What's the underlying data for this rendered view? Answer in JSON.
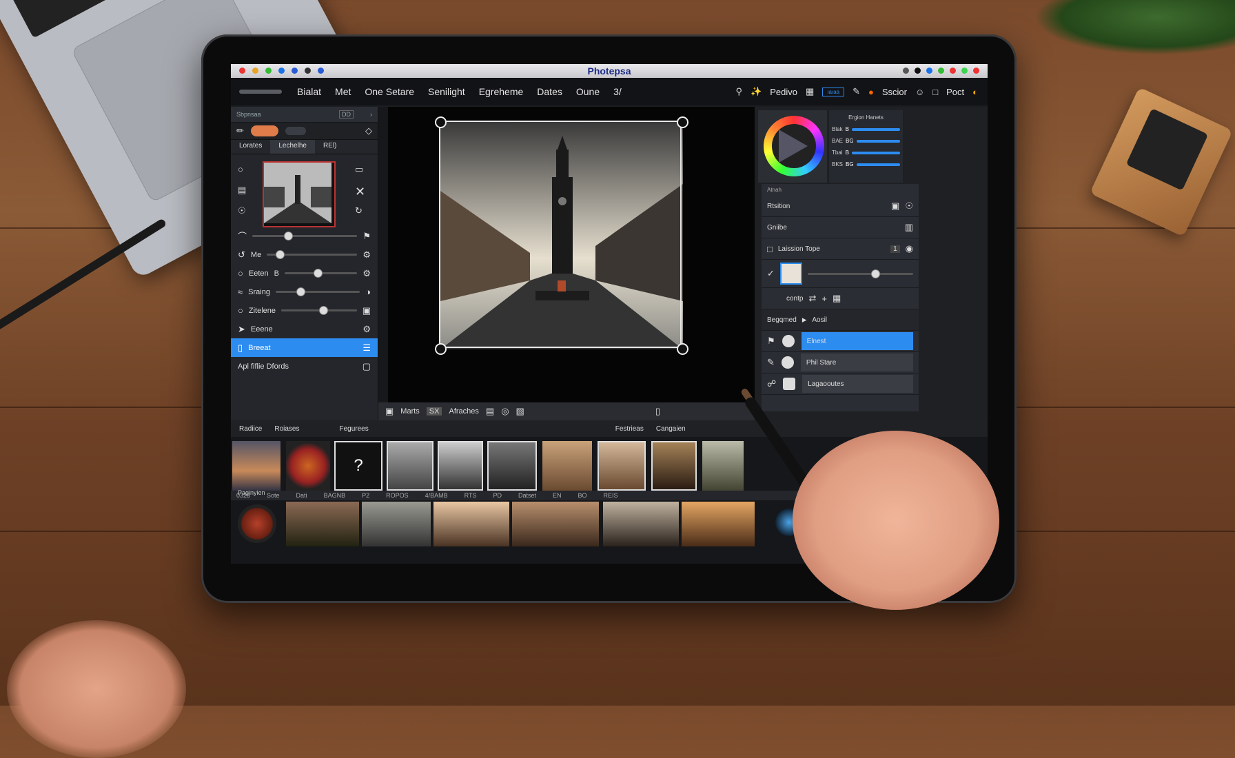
{
  "window": {
    "title": "Photepsa"
  },
  "menu": {
    "items": [
      "Bialat",
      "Met",
      "One Setare",
      "Senilight",
      "Egreheme",
      "Dates",
      "Oune",
      "3/"
    ],
    "right": {
      "search_label": "Pedivo",
      "select_label": "Sscior",
      "post_label": "Poct",
      "badge": "ıaıaa"
    }
  },
  "left_panel": {
    "header": "Sbpnsaa",
    "header_badge": "DD",
    "tabs": [
      "Lorates",
      "Lechelhe",
      "REl)"
    ],
    "rows": [
      {
        "label": "Me",
        "level": 0.1
      },
      {
        "label": "Eeten",
        "suffix": "B",
        "level": 0.4
      },
      {
        "label": "Sraing",
        "level": 0.25
      },
      {
        "label": "Zitelene",
        "level": 0.5
      },
      {
        "label": "Eeene",
        "level": 0
      }
    ],
    "selected": "Breeat",
    "footer": "Apl fiflie Dfords"
  },
  "canvas": {
    "status": [
      "Marts",
      "SX",
      "Afraches"
    ]
  },
  "right_panel": {
    "adjust_title": "Ergion Hanets",
    "adjust_rows": [
      {
        "label": "Blak",
        "value": "B"
      },
      {
        "label": "BAE",
        "value": "BG"
      },
      {
        "label": "Tbal",
        "value": "B"
      },
      {
        "label": "BKS",
        "value": "BG"
      }
    ],
    "props_header": "Atnah",
    "prop_rows": [
      {
        "label": "Rtsition"
      },
      {
        "label": "Gniibe"
      },
      {
        "label": "Laission Tope",
        "value": "1"
      },
      {
        "label": "contp"
      }
    ],
    "layers_header": [
      "Begqmed",
      "Aosil"
    ],
    "layers": [
      {
        "label": "Elnest",
        "selected": true
      },
      {
        "label": "Phil Stare",
        "selected": false
      },
      {
        "label": "Lagaooutes",
        "selected": false
      }
    ]
  },
  "bottom": {
    "tabs": [
      "Radiice",
      "Roiases",
      "Fegurees",
      "Festrieas",
      "Cangaien"
    ],
    "file_info": [
      "0323",
      "Sote",
      "Dati",
      "BAGNB",
      "P2",
      "ROPOS",
      "4/BAMB",
      "RTS",
      "PD",
      "Datset",
      "EN",
      "BO",
      "REIS"
    ],
    "pagination_label": "Paginyien"
  },
  "colors": {
    "accent": "#2d8cf0",
    "desk": "#7a4a2c",
    "bezel": "#0b0b0c"
  }
}
